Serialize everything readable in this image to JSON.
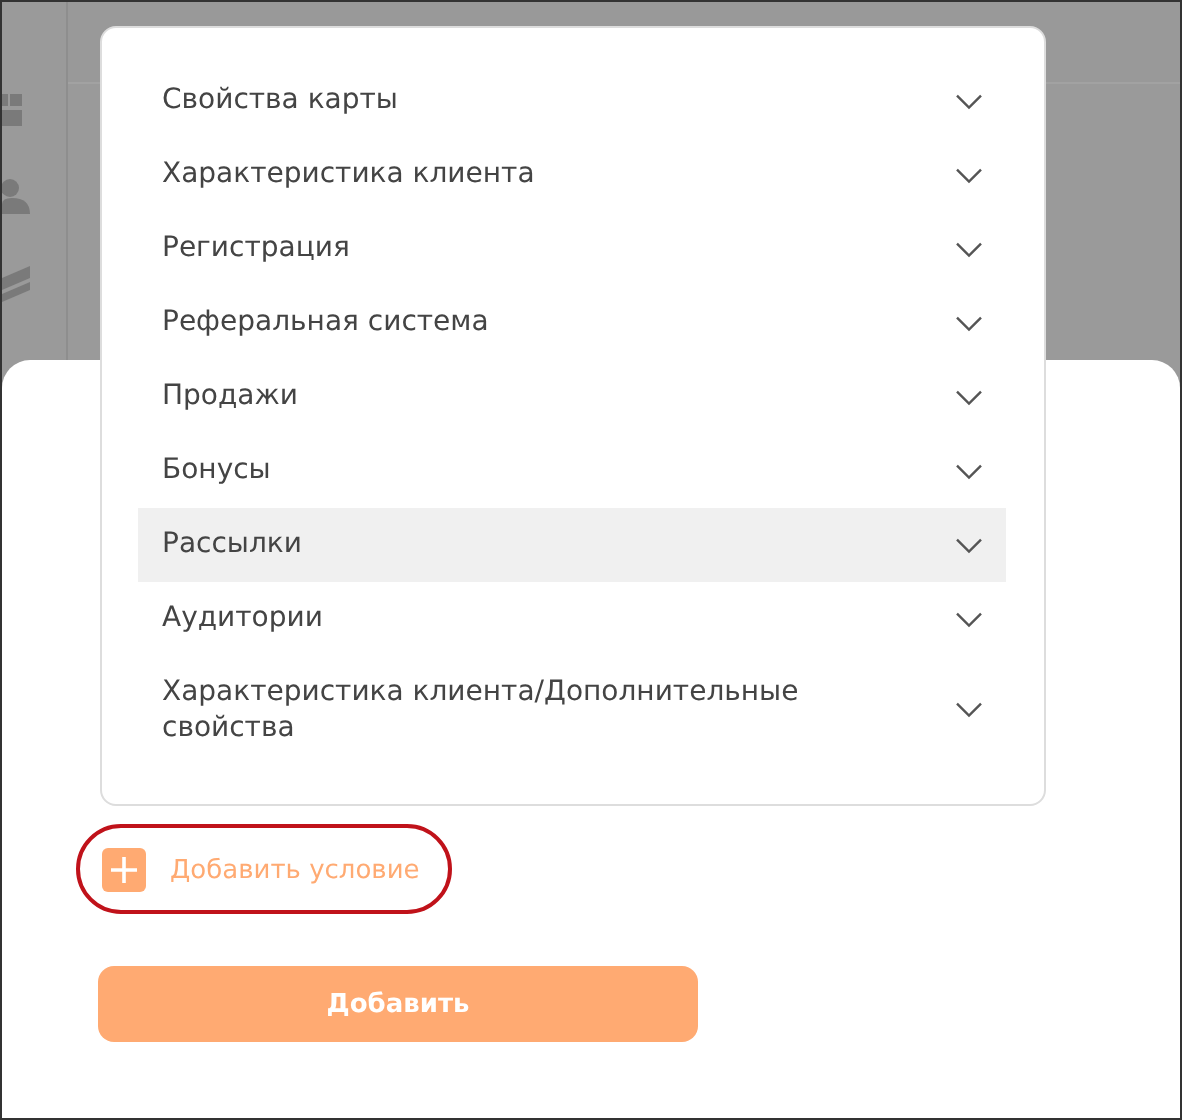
{
  "dropdown": {
    "items": [
      {
        "label": "Свойства карты",
        "highlighted": false
      },
      {
        "label": "Характеристика клиента",
        "highlighted": false
      },
      {
        "label": "Регистрация",
        "highlighted": false
      },
      {
        "label": "Реферальная система",
        "highlighted": false
      },
      {
        "label": "Продажи",
        "highlighted": false
      },
      {
        "label": "Бонусы",
        "highlighted": false
      },
      {
        "label": "Рассылки",
        "highlighted": true
      },
      {
        "label": "Аудитории",
        "highlighted": false
      },
      {
        "label": "Характеристика клиента/Дополнительные свойства",
        "highlighted": false
      }
    ]
  },
  "add_condition": {
    "label": "Добавить условие",
    "circled": true
  },
  "submit_button": {
    "label": "Добавить"
  }
}
